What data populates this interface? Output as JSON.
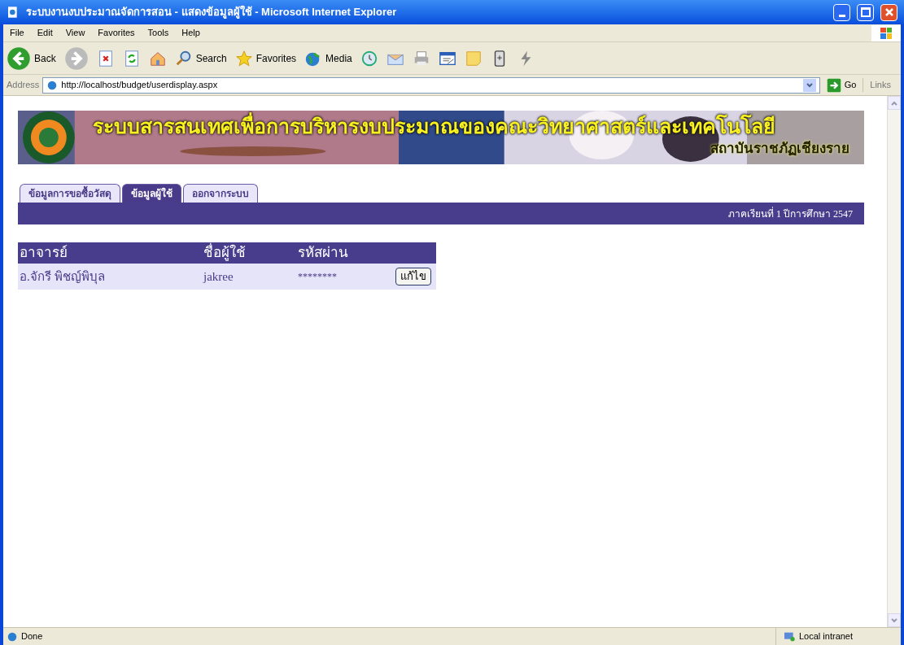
{
  "window": {
    "title": "ระบบงานงบประมาณจัดการสอน - แสดงข้อมูลผู้ใช้ - Microsoft Internet Explorer"
  },
  "menu": [
    "File",
    "Edit",
    "View",
    "Favorites",
    "Tools",
    "Help"
  ],
  "toolbar": [
    {
      "kind": "back",
      "label": "Back"
    },
    {
      "kind": "forward"
    },
    {
      "kind": "stop"
    },
    {
      "kind": "refresh"
    },
    {
      "kind": "home"
    },
    {
      "kind": "search",
      "label": "Search"
    },
    {
      "kind": "favorites",
      "label": "Favorites"
    },
    {
      "kind": "media",
      "label": "Media"
    },
    {
      "kind": "history"
    },
    {
      "kind": "mail"
    },
    {
      "kind": "print"
    },
    {
      "kind": "edit"
    },
    {
      "kind": "note"
    },
    {
      "kind": "messenger"
    },
    {
      "kind": "bolt"
    }
  ],
  "address": {
    "label": "Address",
    "value": "http://localhost/budget/userdisplay.aspx",
    "go": "Go",
    "links": "Links"
  },
  "banner": {
    "title": "ระบบสารสนเทศเพื่อการบริหารงบประมาณของคณะวิทยาศาสตร์และเทคโนโลยี",
    "subtitle": "สถาบันราชภัฏเชียงราย"
  },
  "tabs": [
    {
      "label": "ข้อมูลการขอซื้อวัสดุ",
      "selected": false
    },
    {
      "label": "ข้อมูลผู้ใช้",
      "selected": true
    },
    {
      "label": "ออกจากระบบ",
      "selected": false
    }
  ],
  "semester": "ภาคเรียนที่ 1 ปีการศึกษา 2547",
  "table": {
    "columns": [
      "อาจารย์",
      "ชื่อผู้ใช้",
      "รหัสผ่าน"
    ],
    "rows": [
      {
        "cells": [
          "อ.จักรี พิชญ์พิบุล",
          "jakree",
          "********"
        ],
        "action": "แก้ไข"
      }
    ]
  },
  "status_bar": {
    "status": "Done",
    "zone": "Local intranet"
  }
}
